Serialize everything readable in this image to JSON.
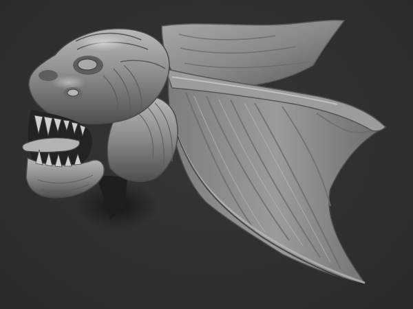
{
  "scene": {
    "subject": "dragon-head-sculpt",
    "background_color": "#313131",
    "material_color": "#8e8e8e",
    "highlight_color": "#d6d6d6",
    "shadow_color": "#1c1c1c"
  }
}
